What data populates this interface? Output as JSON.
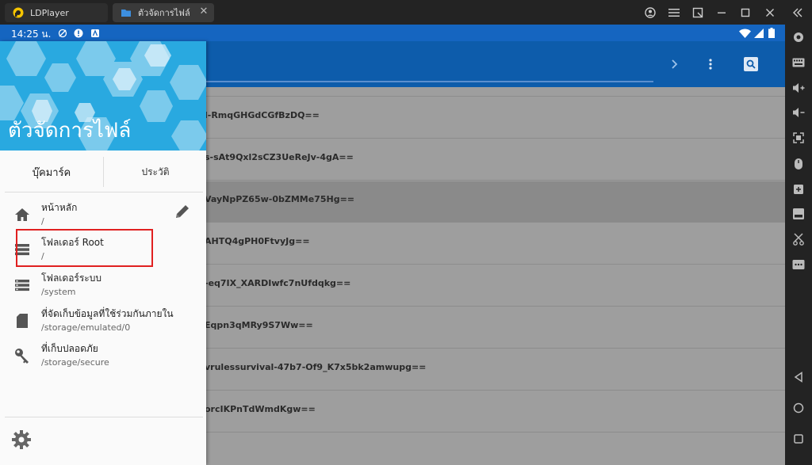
{
  "window": {
    "tabs": [
      {
        "label": "LDPlayer"
      },
      {
        "label": "ตัวจัดการไฟล์"
      }
    ]
  },
  "status_bar": {
    "time": "14:25 น."
  },
  "file_list": {
    "rows": [
      {
        "text": "l-RmqGHGdCGfBzDQ=="
      },
      {
        "text": "s-sAt9Qxl2sCZ3UeReJv-4gA=="
      },
      {
        "text": "VayNpPZ65w-0bZMMe75Hg=="
      },
      {
        "text": "AHTQ4gPH0FtvyJg=="
      },
      {
        "text": "-eq7IX_XARDIwfc7nUfdqkg=="
      },
      {
        "text": "Eqpn3qMRy9S7Ww=="
      },
      {
        "text": "vrulessurvival-47b7-Of9_K7x5bk2amwupg=="
      },
      {
        "text": "orcIKPnTdWmdKgw=="
      }
    ]
  },
  "drawer": {
    "title": "ตัวจัดการไฟล์",
    "tabs": [
      {
        "label": "บุ๊คมาร์ค"
      },
      {
        "label": "ประวัติ"
      }
    ],
    "items": [
      {
        "name": "หน้าหลัก",
        "path": "/"
      },
      {
        "name": "โฟลเดอร์ Root",
        "path": "/"
      },
      {
        "name": "โฟลเดอร์ระบบ",
        "path": "/system"
      },
      {
        "name": "ที่จัดเก็บข้อมูลที่ใช้ร่วมกันภายใน",
        "path": "/storage/emulated/0"
      },
      {
        "name": "ที่เก็บปลอดภัย",
        "path": "/storage/secure"
      }
    ]
  },
  "colors": {
    "status_bar": "#1565c0",
    "app_bar": "#0d5cab",
    "drawer_header": "#29a9e0",
    "highlight_box": "#e02020"
  }
}
